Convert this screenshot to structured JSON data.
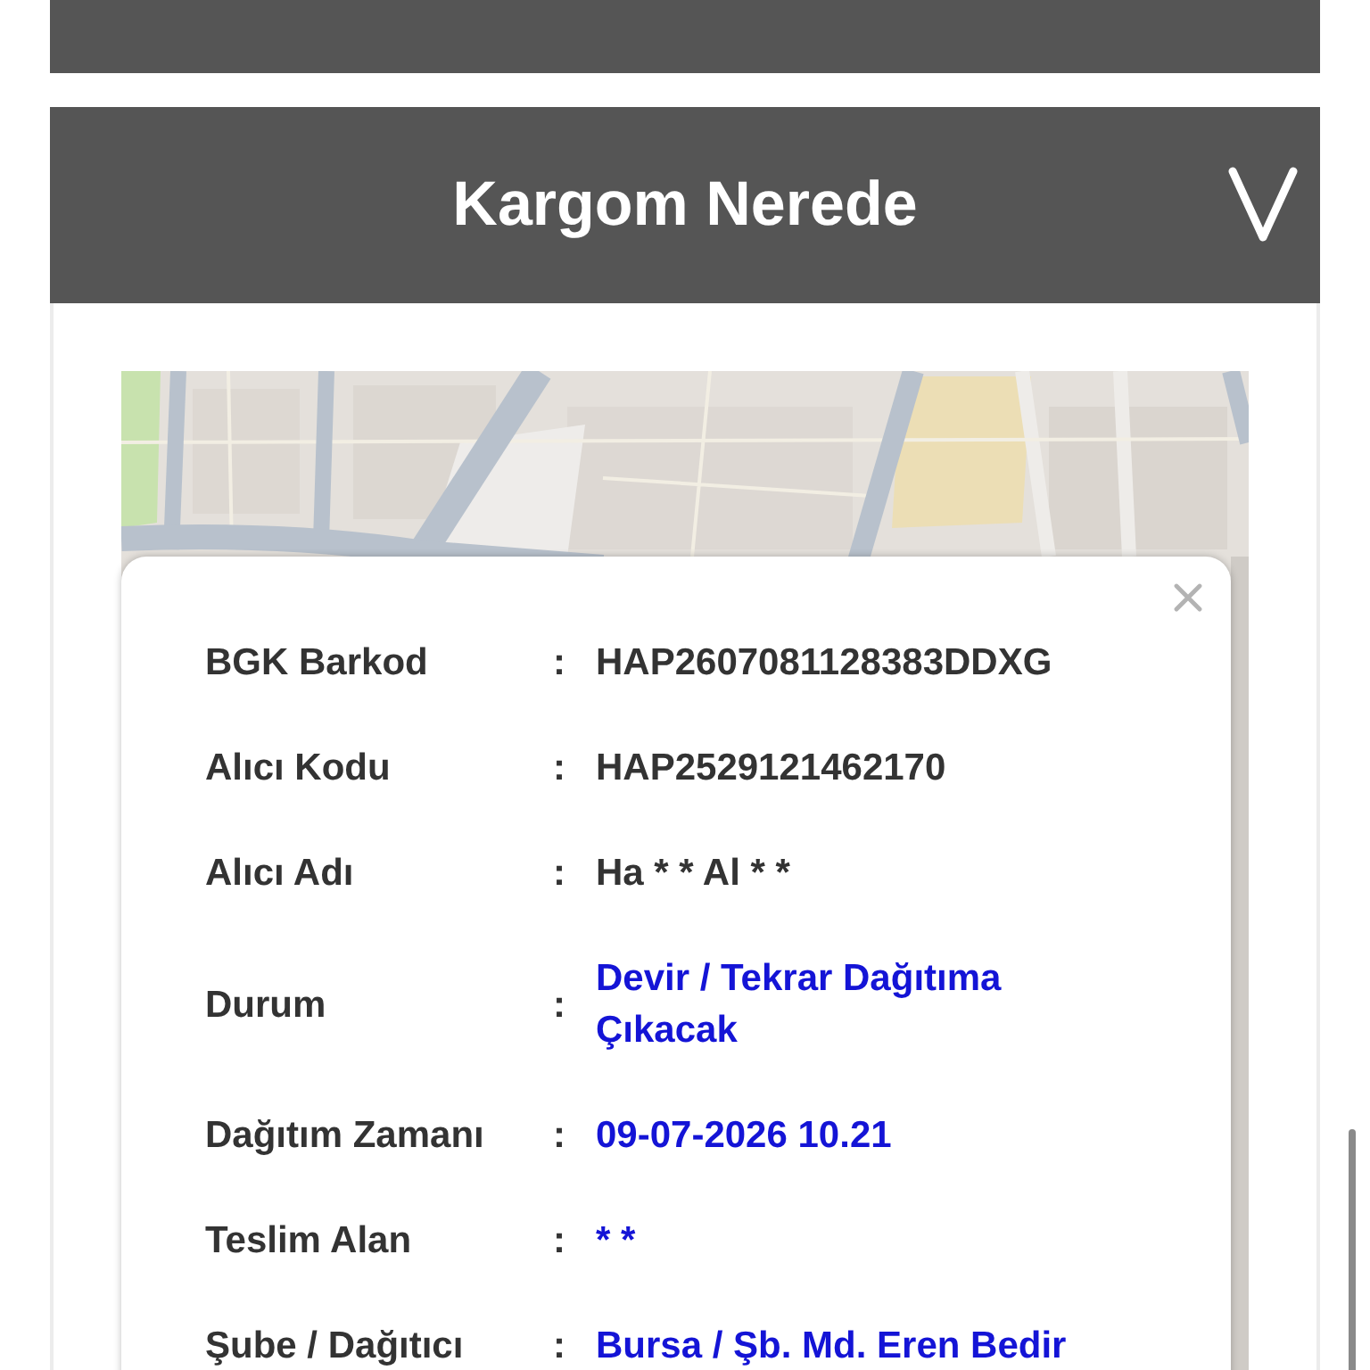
{
  "sections": [
    {
      "expanded": false
    },
    {
      "title": "Kargom Nerede",
      "expanded": true,
      "details": [
        {
          "label": "BGK Barkod",
          "separator": ":",
          "value": "HAP2607081128383DDXG",
          "color": "#333333"
        },
        {
          "label": "Alıcı Kodu",
          "separator": ":",
          "value": "HAP2529121462170",
          "color": "#333333"
        },
        {
          "label": "Alıcı Adı",
          "separator": ":",
          "value": "Ha * * Al * *",
          "color": "#333333"
        },
        {
          "label": "Durum",
          "separator": ":",
          "value": "Devir / Tekrar Dağıtıma Çıkacak",
          "color": "#1414d6"
        },
        {
          "label": "Dağıtım Zamanı",
          "separator": ":",
          "value": "09-07-2026 10.21",
          "color": "#1414d6"
        },
        {
          "label": "Teslim Alan",
          "separator": ":",
          "value": "* *",
          "color": "#1414d6"
        },
        {
          "label": "Şube / Dağıtıcı",
          "separator": ":",
          "value": "Bursa / Şb. Md. Eren Bedir",
          "color": "#1414d6"
        }
      ]
    }
  ]
}
